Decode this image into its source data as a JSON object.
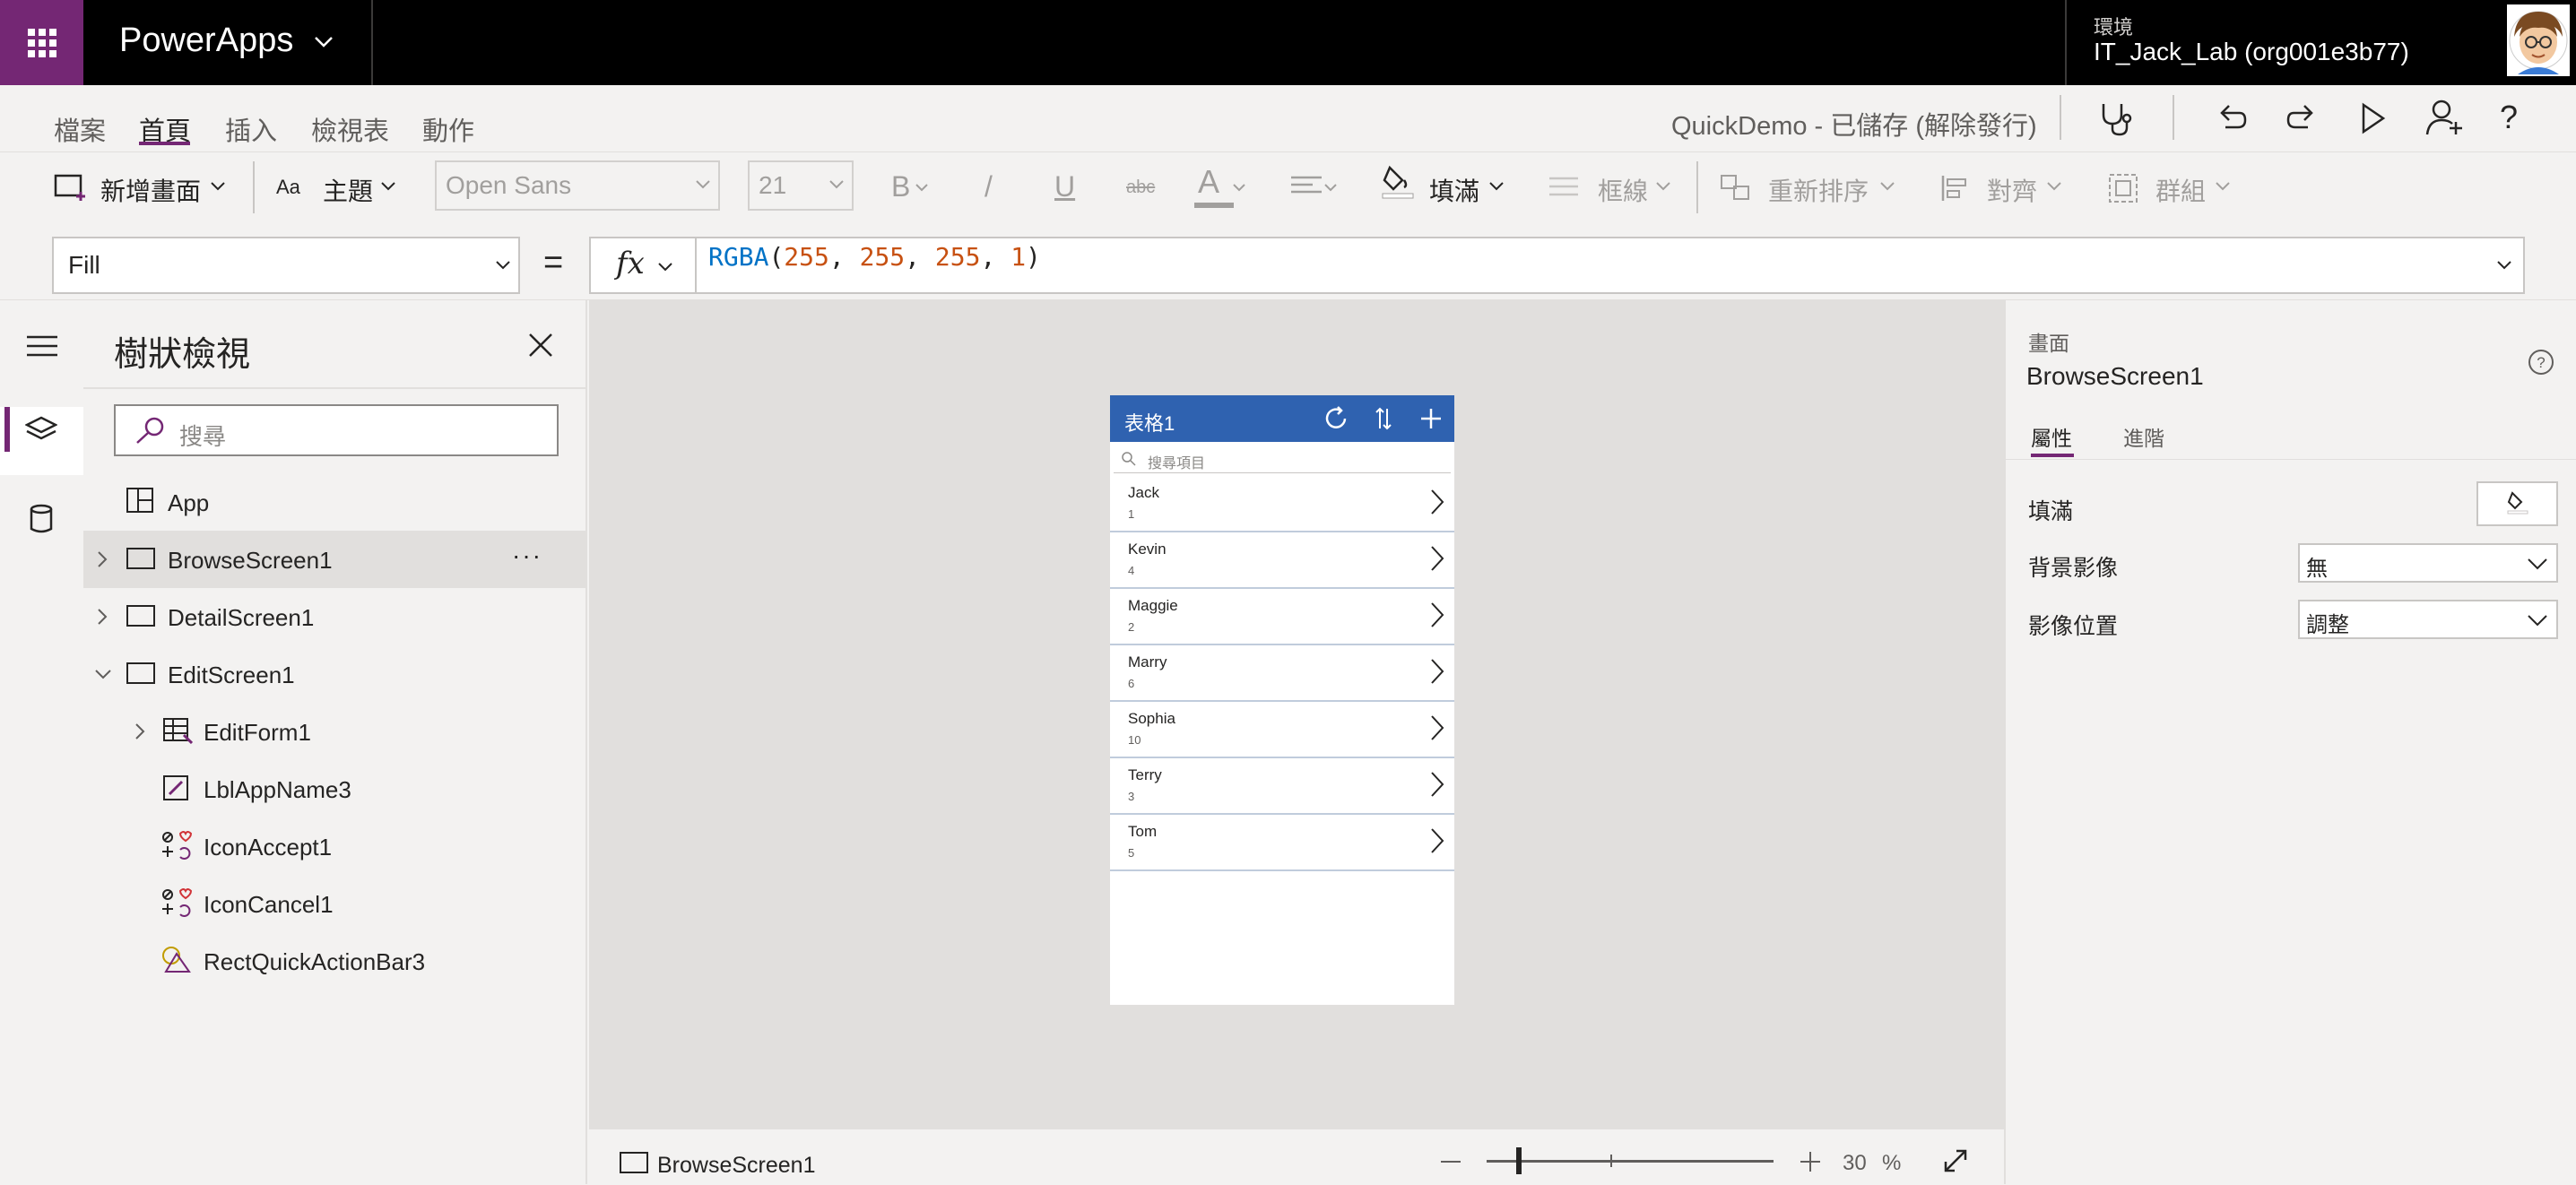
{
  "topbar": {
    "app_title": "PowerApps",
    "environment_label": "環境",
    "environment_name": "IT_Jack_Lab (org001e3b77)"
  },
  "menu": {
    "tabs": [
      "檔案",
      "首頁",
      "插入",
      "檢視表",
      "動作"
    ],
    "active_tab": "首頁",
    "doc_status": "QuickDemo - 已儲存 (解除發行)"
  },
  "ribbon": {
    "new_screen": "新增畫面",
    "theme": "主題",
    "font_family": "Open Sans",
    "font_size": "21",
    "bold": "B",
    "italic": "/",
    "underline": "U",
    "strikethrough": "abc",
    "font_color": "A",
    "fill": "填滿",
    "border": "框線",
    "reorder": "重新排序",
    "align": "對齊",
    "group": "群組"
  },
  "formula_bar": {
    "property": "Fill",
    "equals": "=",
    "fx": "fx",
    "func": "RGBA",
    "args": [
      "255",
      "255",
      "255",
      "1"
    ]
  },
  "tree": {
    "title": "樹狀檢視",
    "search_placeholder": "搜尋",
    "items": [
      {
        "label": "App"
      },
      {
        "label": "BrowseScreen1"
      },
      {
        "label": "DetailScreen1"
      },
      {
        "label": "EditScreen1"
      },
      {
        "label": "EditForm1"
      },
      {
        "label": "LblAppName3"
      },
      {
        "label": "IconAccept1"
      },
      {
        "label": "IconCancel1"
      },
      {
        "label": "RectQuickActionBar3"
      }
    ],
    "more": "···"
  },
  "phone": {
    "title": "表格1",
    "search_placeholder": "搜尋項目",
    "items": [
      {
        "name": "Jack",
        "num": "1"
      },
      {
        "name": "Kevin",
        "num": "4"
      },
      {
        "name": "Maggie",
        "num": "2"
      },
      {
        "name": "Marry",
        "num": "6"
      },
      {
        "name": "Sophia",
        "num": "10"
      },
      {
        "name": "Terry",
        "num": "3"
      },
      {
        "name": "Tom",
        "num": "5"
      }
    ]
  },
  "status": {
    "screen_label": "BrowseScreen1",
    "zoom_value": "30",
    "zoom_unit": "%",
    "zoom_level": 0.3
  },
  "properties": {
    "type": "畫面",
    "name": "BrowseScreen1",
    "tabs": [
      "屬性",
      "進階"
    ],
    "fill_label": "填滿",
    "bg_image_label": "背景影像",
    "bg_image_value": "無",
    "image_position_label": "影像位置",
    "image_position_value": "調整"
  },
  "colors": {
    "brand": "#742774",
    "phone_header": "#2f62b0"
  }
}
